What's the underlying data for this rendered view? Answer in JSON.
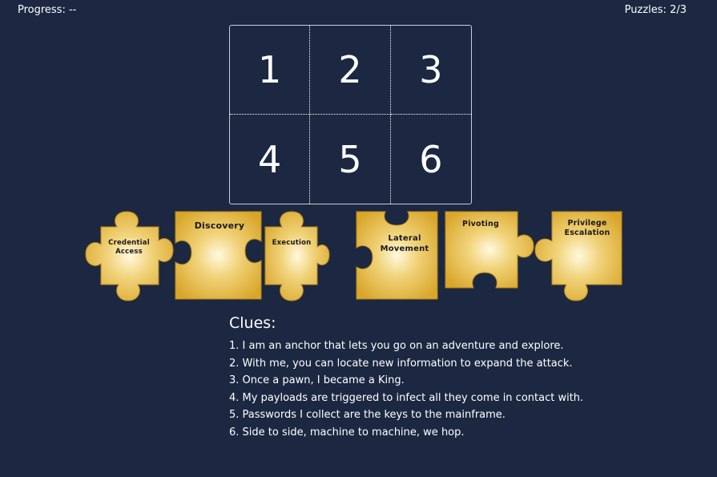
{
  "header": {
    "progress": "Progress: --",
    "puzzles": "Puzzles: 2/3"
  },
  "grid": {
    "cells": [
      "1",
      "2",
      "3",
      "4",
      "5",
      "6"
    ]
  },
  "pieces": [
    {
      "id": "credential-access",
      "lines": [
        "Credential",
        "Access"
      ]
    },
    {
      "id": "discovery",
      "lines": [
        "Discovery"
      ]
    },
    {
      "id": "execution",
      "lines": [
        "Execution"
      ]
    },
    {
      "id": "lateral-movement",
      "lines": [
        "Lateral",
        "Movement"
      ]
    },
    {
      "id": "pivoting",
      "lines": [
        "Pivoting"
      ]
    },
    {
      "id": "privilege-escalation",
      "lines": [
        "Privilege",
        "Escalation"
      ]
    }
  ],
  "clues": {
    "title": "Clues:",
    "items": [
      "1. I am an anchor that lets you go on an adventure and explore.",
      "2. With me, you can locate new information to expand the attack.",
      "3. Once a pawn, I became a King.",
      "4. My payloads are triggered to infect all they come in contact with.",
      "5. Passwords I collect are the keys to the mainframe.",
      "6. Side to side, machine to machine, we hop."
    ]
  },
  "colors": {
    "background": "#1c2841",
    "piece_center": "#fff9e0",
    "piece_edge": "#d9a62a",
    "piece_stroke": "#b8861a"
  }
}
